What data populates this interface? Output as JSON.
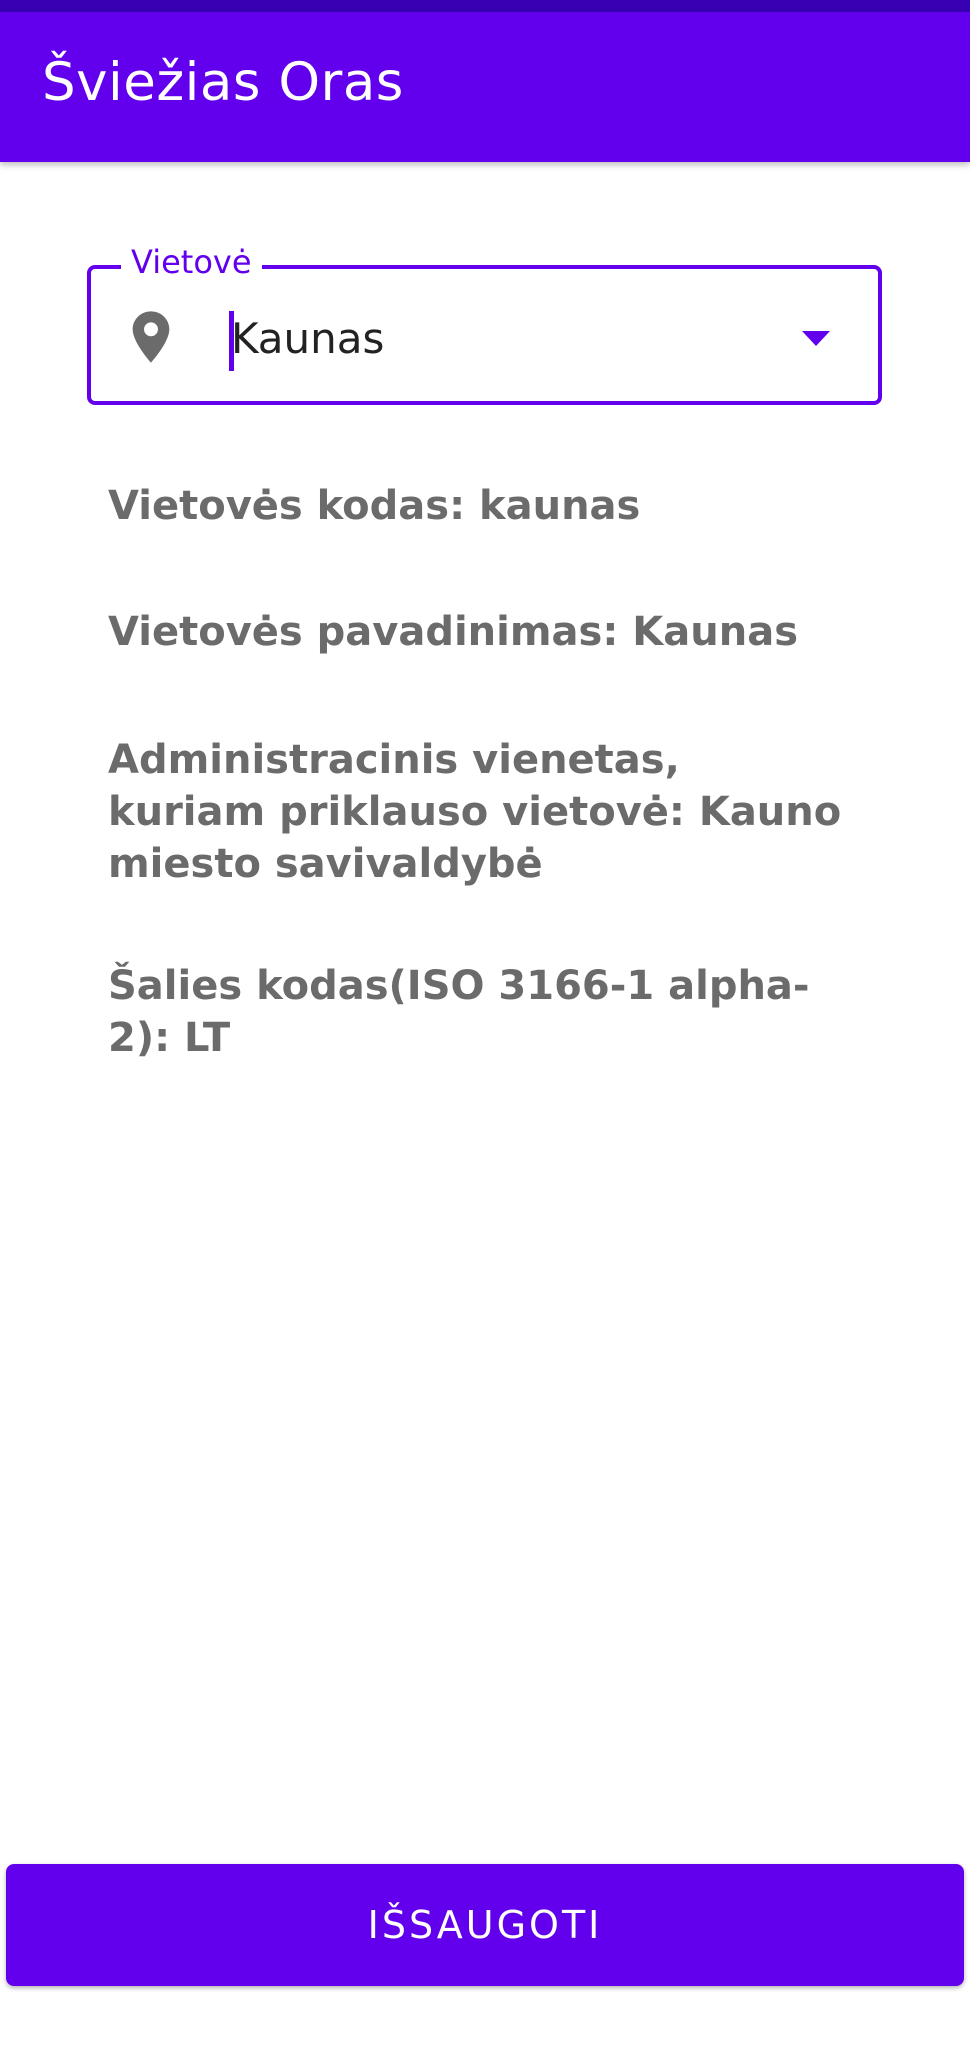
{
  "app_bar": {
    "title": "Šviežias Oras",
    "color": "#6200ee",
    "status_bar_color": "#3700b3"
  },
  "location_field": {
    "label": "Vietovė",
    "value": "Kaunas",
    "leading_icon": "location-pin-icon",
    "trailing_icon": "dropdown-arrow-icon"
  },
  "details": {
    "code": "Vietovės kodas: kaunas",
    "name": "Vietovės pavadinimas: Kaunas",
    "admin_unit": "Administracinis vienetas, kuriam priklauso vietovė: Kauno miesto savivaldybė",
    "country_code": "Šalies kodas(ISO 3166-1 alpha-2): LT"
  },
  "save_button": {
    "label": "IŠSAUGOTI"
  }
}
